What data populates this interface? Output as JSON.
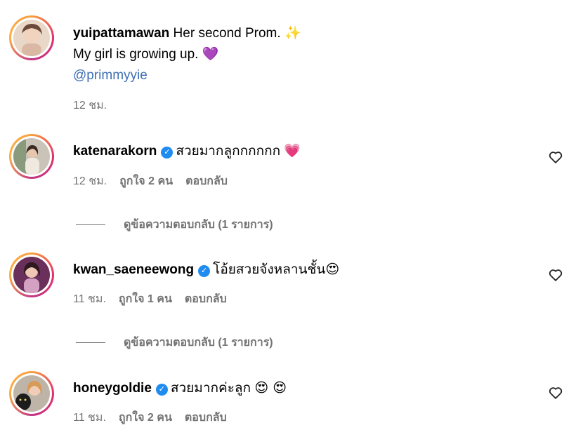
{
  "caption": {
    "username": "yuipattamawan",
    "text_line1": "Her second Prom.",
    "sparkle": "✨",
    "text_line2": "My girl is growing up.",
    "heart": "💜",
    "mention": "@primmyyie",
    "time": "12 ชม."
  },
  "comments": [
    {
      "username": "katenarakorn",
      "text": "สวยมากลูกกกกกก",
      "emoji": "💗",
      "time": "12 ชม.",
      "likes": "ถูกใจ 2 คน",
      "reply": "ตอบกลับ",
      "view_replies": "ดูข้อความตอบกลับ (1 รายการ)"
    },
    {
      "username": "kwan_saeneewong",
      "text": "โอ้ยสวยจังหลานชั้น",
      "emoji": "😍",
      "time": "11 ชม.",
      "likes": "ถูกใจ 1 คน",
      "reply": "ตอบกลับ",
      "view_replies": "ดูข้อความตอบกลับ (1 รายการ)"
    },
    {
      "username": "honeygoldie",
      "text": "สวยมากค่ะลูก",
      "emoji": "😍 😍",
      "time": "11 ชม.",
      "likes": "ถูกใจ 2 คน",
      "reply": "ตอบกลับ"
    }
  ],
  "verified_icon": "✓",
  "colors": {
    "meta": "#737373",
    "verified": "#1f8cf0",
    "mention": "#3d6fb4"
  }
}
